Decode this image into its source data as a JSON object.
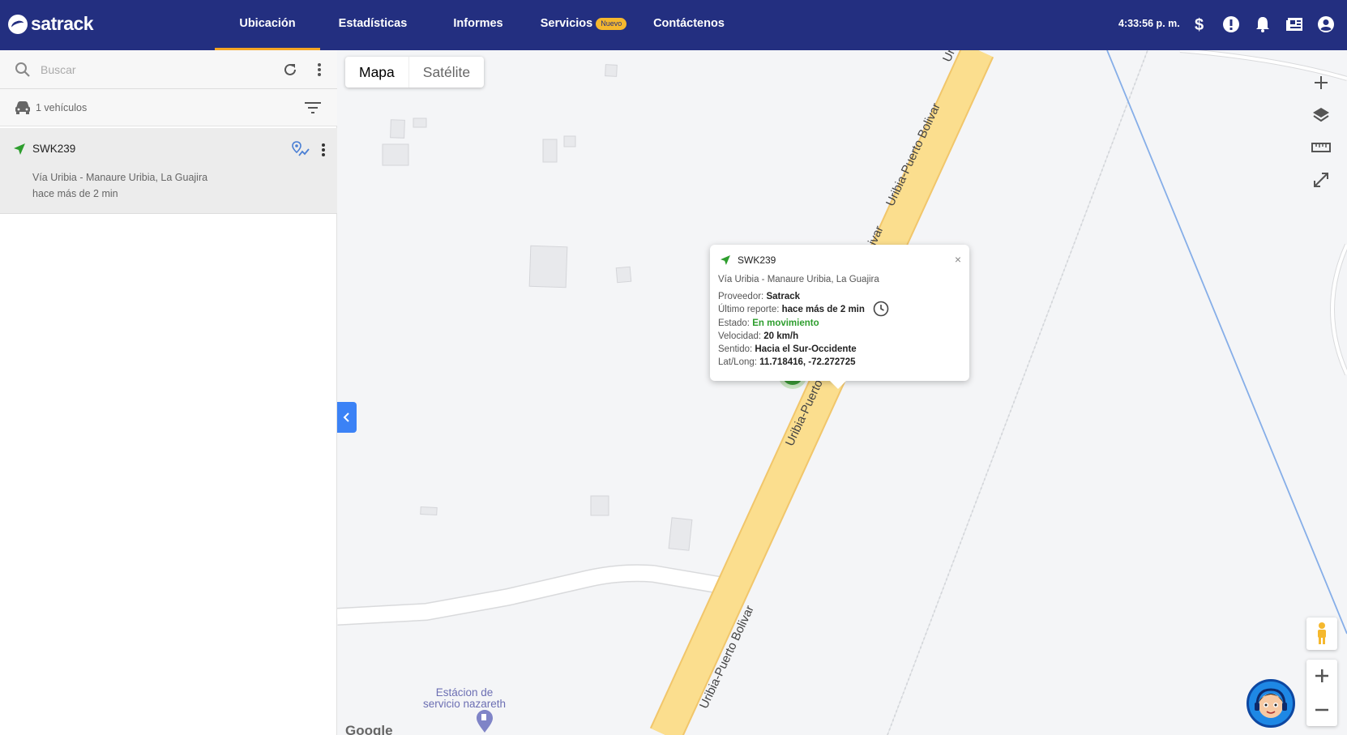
{
  "brand": {
    "name": "satrack"
  },
  "nav": {
    "items": [
      {
        "label": "Ubicación",
        "active": true
      },
      {
        "label": "Estadísticas"
      },
      {
        "label": "Informes"
      },
      {
        "label": "Servicios",
        "badge": "Nuevo"
      },
      {
        "label": "Contáctenos"
      }
    ]
  },
  "topbar": {
    "time": "4:33:56 p. m.",
    "icons": [
      "dollar-icon",
      "alert-icon",
      "bell-icon",
      "news-icon",
      "account-icon"
    ]
  },
  "sidebar": {
    "search_placeholder": "Buscar",
    "vehicles_count": "1 vehículos",
    "vehicle": {
      "plate": "SWK239",
      "address": "Vía Uribia - Manaure Uribia, La Guajira",
      "last_report": "hace más de 2 min"
    }
  },
  "map": {
    "type_options": {
      "map": "Mapa",
      "satellite": "Satélite"
    },
    "road_labels": [
      "Uribia-Puerto Bolivar",
      "Uribia-Puerto Bolivar",
      "Uribia-Puerto B",
      "Uribia-P",
      "ivar"
    ],
    "poi": {
      "line1": "Estácion de",
      "line2": "servicio nazareth"
    },
    "attribution": "Google"
  },
  "popup": {
    "plate": "SWK239",
    "address": "Vía Uribia - Manaure Uribia, La Guajira",
    "provider_label": "Proveedor:",
    "provider": "Satrack",
    "last_report_label": "Último reporte:",
    "last_report": "hace más de 2 min",
    "status_label": "Estado:",
    "status": "En movimiento",
    "speed_label": "Velocidad:",
    "speed": "20 km/h",
    "direction_label": "Sentido:",
    "direction": "Hacia el Sur-Occidente",
    "latlong_label": "Lat/Long:",
    "latlong": "11.718416, -72.272725",
    "close": "×"
  },
  "colors": {
    "topbar": "#232f80",
    "accent": "#f5a623",
    "status_moving": "#2e9e2e",
    "road": "#fbde8e",
    "collapse": "#3b82f6"
  }
}
